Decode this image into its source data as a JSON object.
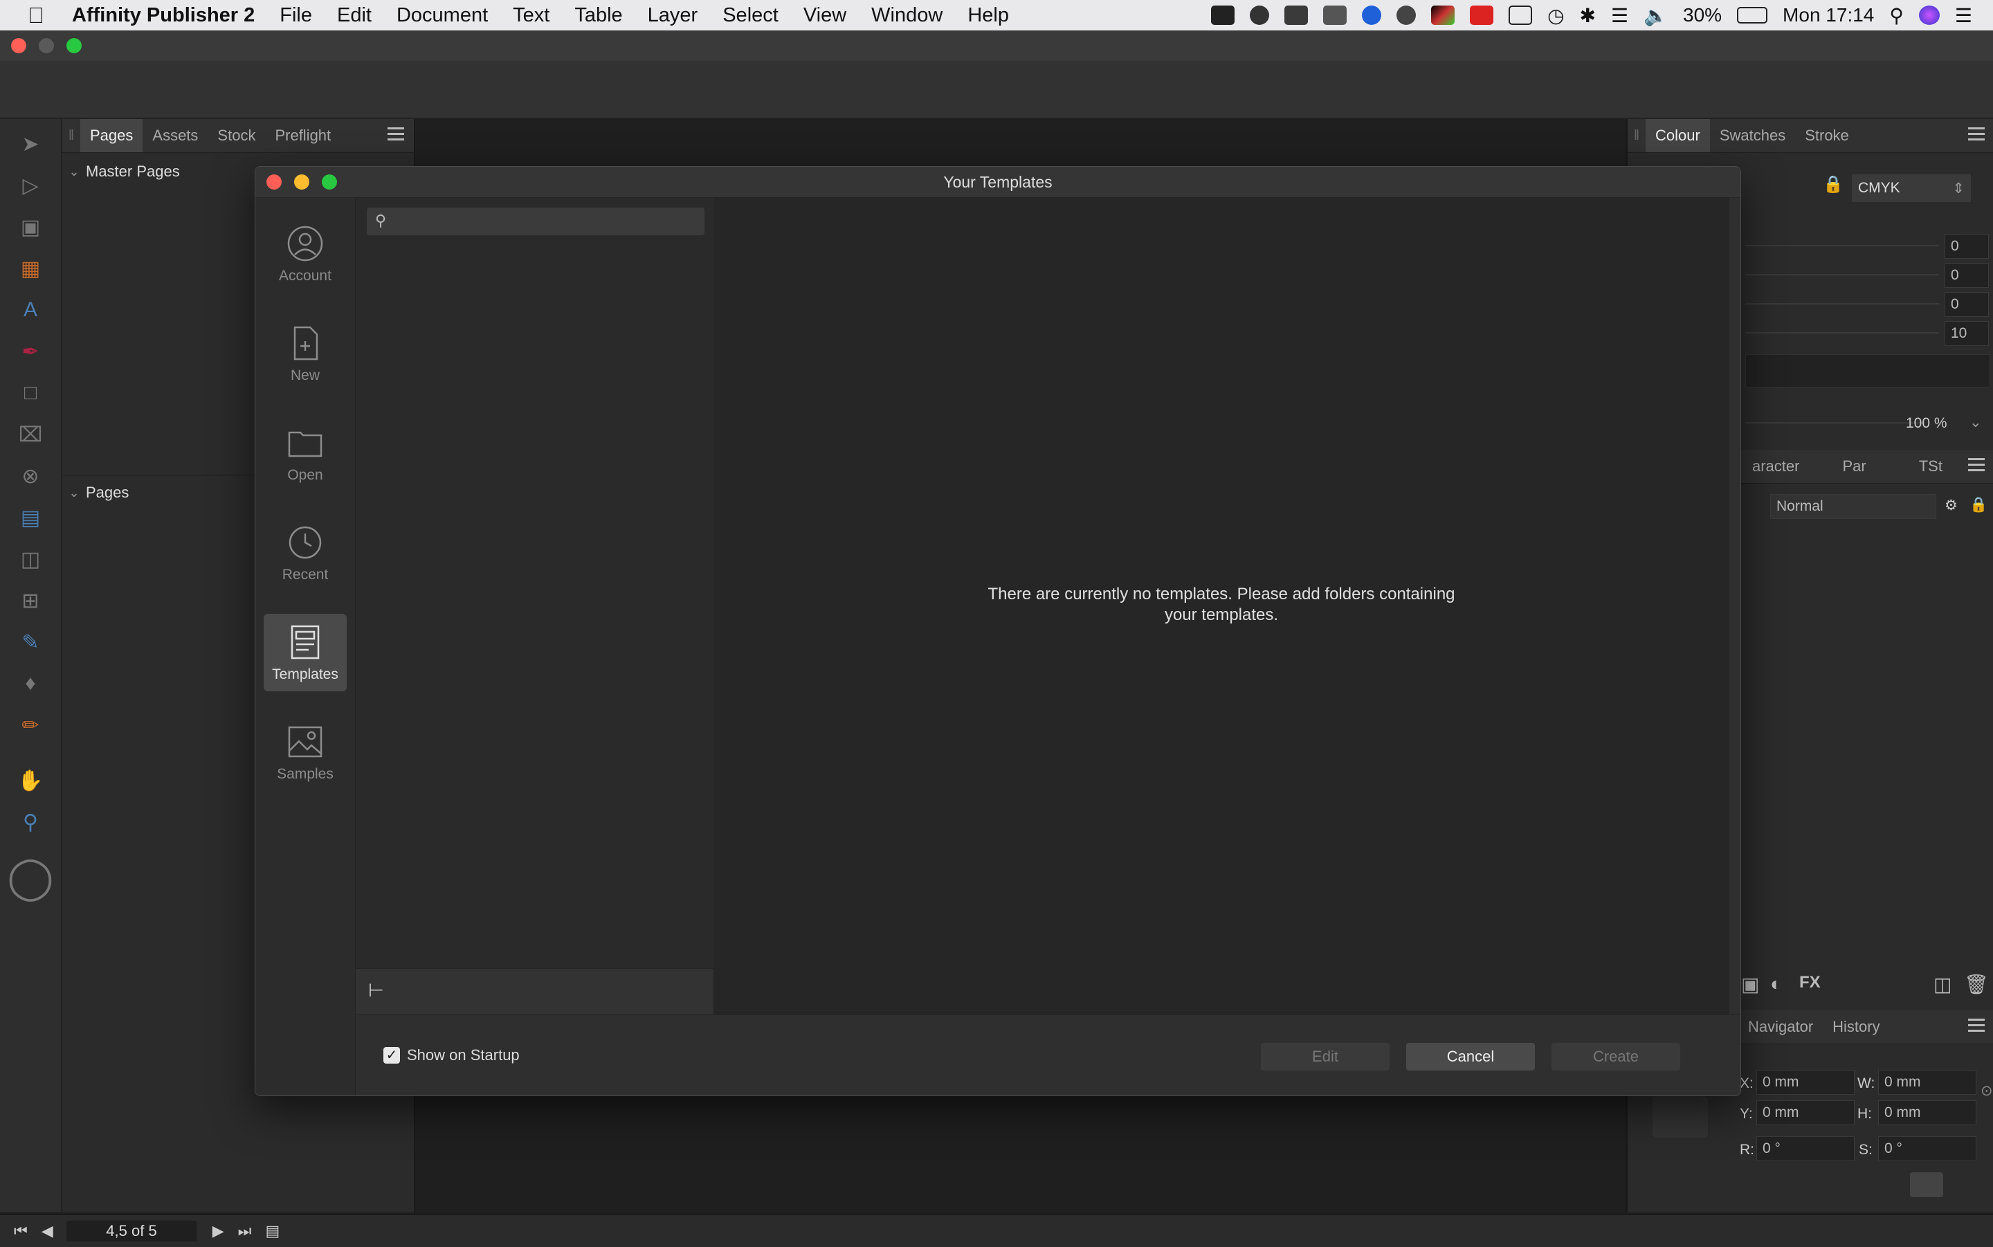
{
  "menubar": {
    "app_name": "Affinity Publisher 2",
    "menus": [
      "File",
      "Edit",
      "Document",
      "Text",
      "Table",
      "Layer",
      "Select",
      "View",
      "Window",
      "Help"
    ],
    "battery": "30%",
    "clock": "Mon 17:14"
  },
  "left_panel": {
    "tabs": [
      "Pages",
      "Assets",
      "Stock",
      "Preflight"
    ],
    "active_tab": "Pages",
    "master_pages_label": "Master Pages",
    "pages_label": "Pages"
  },
  "right_panel": {
    "tabs": [
      "Colour",
      "Swatches",
      "Stroke"
    ],
    "color_model": "CMYK",
    "cmyk_values": [
      "0",
      "0",
      "0",
      "10"
    ],
    "opacity": "100 %",
    "text_tabs": [
      "aracter",
      "Par",
      "TSt"
    ],
    "style_select": "Normal",
    "nav_tabs": [
      "Navigator",
      "History"
    ],
    "transform": {
      "x_label": "X:",
      "x_value": "0 mm",
      "w_label": "W:",
      "w_value": "0 mm",
      "y_label": "Y:",
      "y_value": "0 mm",
      "h_label": "H:",
      "h_value": "0 mm",
      "r_label": "R:",
      "r_value": "0 °",
      "s_label": "S:",
      "s_value": "0 °"
    }
  },
  "bottom_bar": {
    "page_indicator": "4,5 of 5"
  },
  "dialog": {
    "title": "Your Templates",
    "nav": [
      {
        "label": "Account",
        "icon": "account-icon"
      },
      {
        "label": "New",
        "icon": "new-document-icon"
      },
      {
        "label": "Open",
        "icon": "folder-icon"
      },
      {
        "label": "Recent",
        "icon": "recent-clock-icon"
      },
      {
        "label": "Templates",
        "icon": "templates-icon"
      },
      {
        "label": "Samples",
        "icon": "samples-icon"
      }
    ],
    "selected_nav": "Templates",
    "search_placeholder": "",
    "empty_line1": "There are currently no templates. Please add folders containing",
    "empty_line2": "your templates.",
    "show_on_startup_label": "Show on Startup",
    "show_on_startup_checked": true,
    "buttons": {
      "edit": "Edit",
      "cancel": "Cancel",
      "create": "Create"
    }
  },
  "colors": {
    "menubar_bg": "#e9e9ec",
    "dialog_bg": "#2f2f2f",
    "selected_nav_bg": "#4a4a4a",
    "traffic_close": "#ff5f57",
    "traffic_min": "#febc2e",
    "traffic_max": "#28c840"
  }
}
